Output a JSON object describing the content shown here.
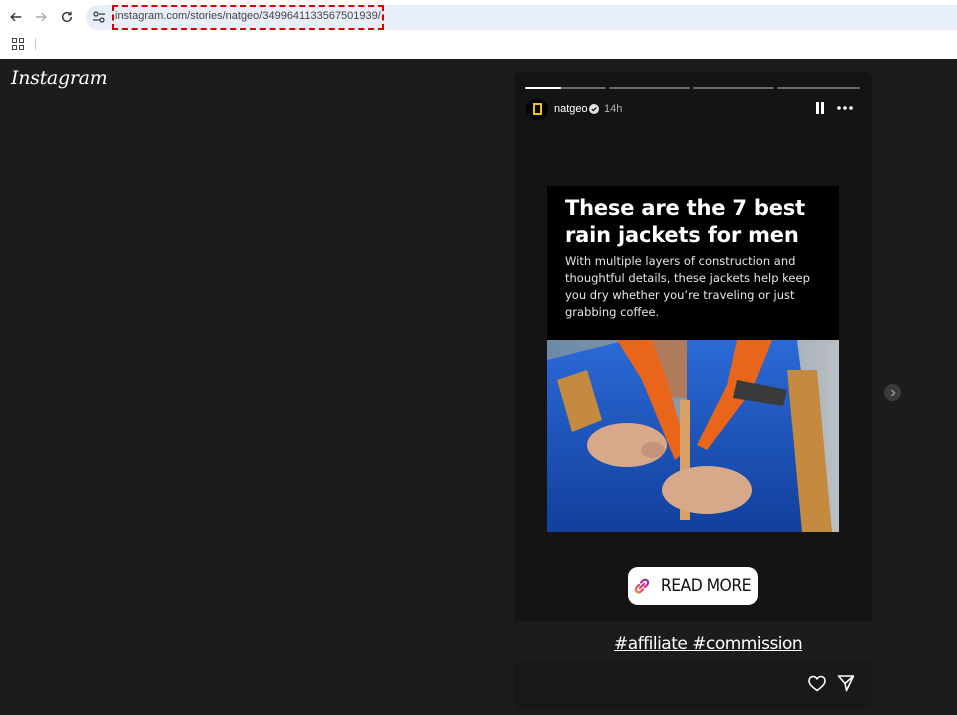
{
  "browser": {
    "url": "instagram.com/stories/natgeo/3499641133567501939/",
    "back_icon": "arrow-left-icon",
    "forward_icon": "arrow-right-icon",
    "reload_icon": "reload-icon",
    "site_info_icon": "tune-icon",
    "apps_icon": "apps-grid-icon"
  },
  "page": {
    "logo": "Instagram"
  },
  "story": {
    "progress": [
      0.45,
      0,
      0,
      0
    ],
    "username": "natgeo",
    "time": "14h",
    "card": {
      "title": "These are the 7 best rain jackets for men",
      "body": "With multiple layers of construction and thoughtful details, these jackets help keep you dry whether you’re traveling or just grabbing coffee."
    },
    "link_sticker": "READ MORE",
    "hashtags": "#affiliate #commission"
  },
  "colors": {
    "background": "#1c1c1c",
    "story_bg": "#141414",
    "natgeo_yellow": "#f6c500",
    "jacket_blue": "#1d57c4",
    "jacket_orange": "#e8651a"
  }
}
